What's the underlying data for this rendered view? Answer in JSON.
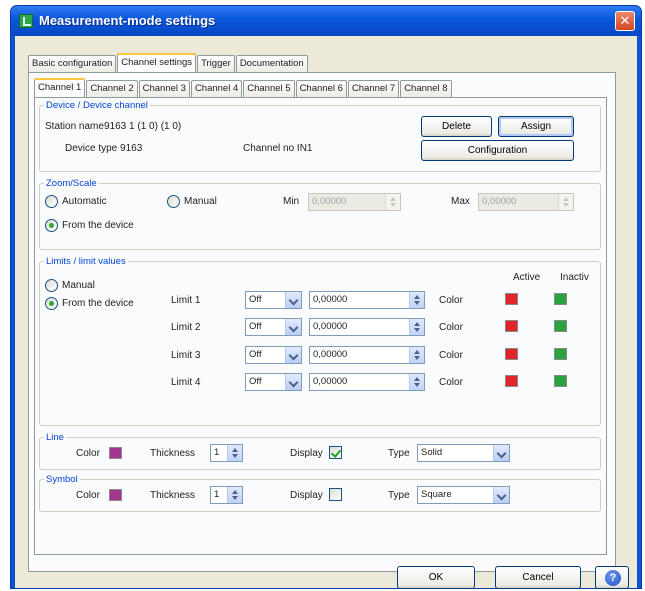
{
  "window": {
    "title": "Measurement-mode settings",
    "close_label": "✕"
  },
  "top_tabs": [
    "Basic configuration",
    "Channel settings",
    "Trigger",
    "Documentation"
  ],
  "channel_tabs": [
    "Channel 1",
    "Channel 2",
    "Channel 3",
    "Channel 4",
    "Channel 5",
    "Channel 6",
    "Channel 7",
    "Channel 8"
  ],
  "device": {
    "legend": "Device / Device channel",
    "station_label": "Station name",
    "station_value": "9163 1 (1 0) (1 0)",
    "type_label": "Device type 9163",
    "channel_no": "Channel no IN1",
    "delete_label": "Delete",
    "assign_label": "Assign",
    "configuration_label": "Configuration"
  },
  "zoom": {
    "legend": "Zoom/Scale",
    "automatic": "Automatic",
    "manual": "Manual",
    "from_device": "From the device",
    "min_label": "Min",
    "min_value": "0,00000",
    "max_label": "Max",
    "max_value": "0,00000"
  },
  "limits": {
    "legend": "Limits / limit values",
    "manual": "Manual",
    "from_device": "From the device",
    "active_header": "Active",
    "inactive_header": "Inactiv",
    "color_label": "Color",
    "rows": [
      {
        "label": "Limit 1",
        "mode": "Off",
        "value": "0,00000"
      },
      {
        "label": "Limit 2",
        "mode": "Off",
        "value": "0,00000"
      },
      {
        "label": "Limit 3",
        "mode": "Off",
        "value": "0,00000"
      },
      {
        "label": "Limit 4",
        "mode": "Off",
        "value": "0,00000"
      }
    ],
    "active_color": "#e0262a",
    "inactive_color": "#2ca23e"
  },
  "line": {
    "legend": "Line",
    "color_label": "Color",
    "color": "#a3378f",
    "thickness_label": "Thickness",
    "thickness": "1",
    "display_label": "Display",
    "display_checked": true,
    "type_label": "Type",
    "type_value": "Solid"
  },
  "symbol": {
    "legend": "Symbol",
    "color_label": "Color",
    "color": "#a3378f",
    "thickness_label": "Thickness",
    "thickness": "1",
    "display_label": "Display",
    "display_checked": false,
    "type_label": "Type",
    "type_value": "Square"
  },
  "footer": {
    "ok_label": "OK",
    "cancel_label": "Cancel",
    "help_icon": "question-mark-icon"
  }
}
